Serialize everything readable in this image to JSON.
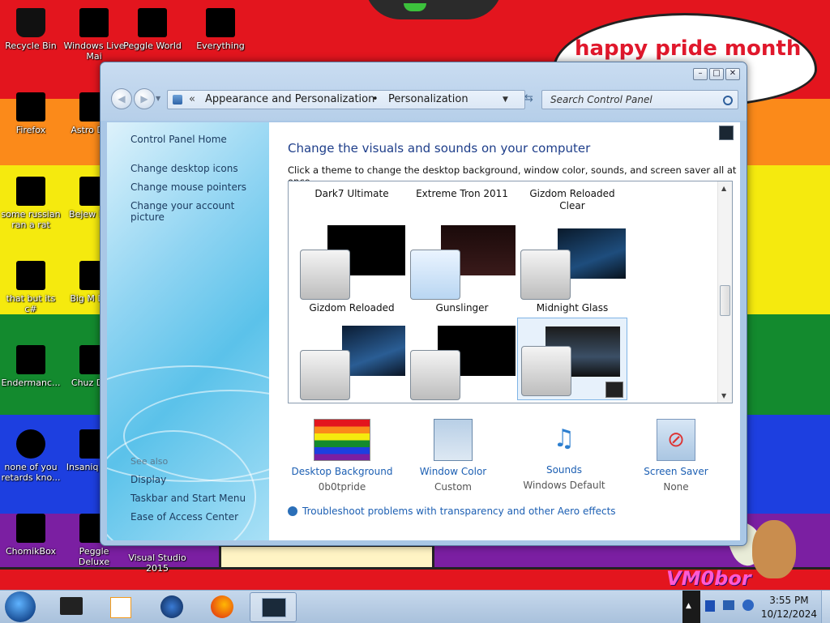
{
  "desktop": {
    "bubble_text": "happy pride month",
    "watermark": "VM0bor",
    "icons": [
      {
        "label": "Recycle Bin"
      },
      {
        "label": "Windows Live Mai"
      },
      {
        "label": "Peggle World"
      },
      {
        "label": "Everything"
      },
      {
        "label": "Firefox"
      },
      {
        "label": "Astro Delu"
      },
      {
        "label": "some russian ran a rat"
      },
      {
        "label": "Bejew Delu"
      },
      {
        "label": "that but its c#"
      },
      {
        "label": "Big M Delu"
      },
      {
        "label": "Endermanc..."
      },
      {
        "label": "Chuz Delu"
      },
      {
        "label": "none of you retards kno..."
      },
      {
        "label": "Insaniq Delu"
      },
      {
        "label": "ChomikBox"
      },
      {
        "label": "Peggle Deluxe"
      },
      {
        "label": "Visual Studio 2015"
      }
    ]
  },
  "window": {
    "address": {
      "crumb1": "Appearance and Personalization",
      "sep": "•",
      "crumb2": "Personalization"
    },
    "search_placeholder": "Search Control Panel",
    "controls": {
      "minimize": "–",
      "maximize": "□",
      "close": "✕"
    },
    "sidebar": {
      "home": "Control Panel Home",
      "links": [
        "Change desktop icons",
        "Change mouse pointers",
        "Change your account picture"
      ],
      "see_also": "See also",
      "also_links": [
        "Display",
        "Taskbar and Start Menu",
        "Ease of Access Center"
      ]
    },
    "main": {
      "heading": "Change the visuals and sounds on your computer",
      "subtext": "Click a theme to change the desktop background, window color, sounds, and screen saver all at once.",
      "themes_row1": [
        "Dark7 Ultimate",
        "Extreme Tron 2011",
        "Gizdom Reloaded Clear"
      ],
      "themes_row2": [
        "Gizdom Reloaded",
        "Gunslinger",
        "Midnight Glass"
      ],
      "options": [
        {
          "label": "Desktop Background",
          "value": "0b0tpride"
        },
        {
          "label": "Window Color",
          "value": "Custom"
        },
        {
          "label": "Sounds",
          "value": "Windows Default"
        },
        {
          "label": "Screen Saver",
          "value": "None"
        }
      ],
      "troubleshoot": "Troubleshoot problems with transparency and other Aero effects"
    }
  },
  "taskbar": {
    "time": "3:55 PM",
    "date": "10/12/2024"
  },
  "colors": {
    "link": "#1c5fb3",
    "heading": "#1e3e8a",
    "pride": [
      "#e3151e",
      "#fb8a1a",
      "#f5ea0e",
      "#138a2e",
      "#1d3fe0",
      "#7b1fa2"
    ]
  }
}
